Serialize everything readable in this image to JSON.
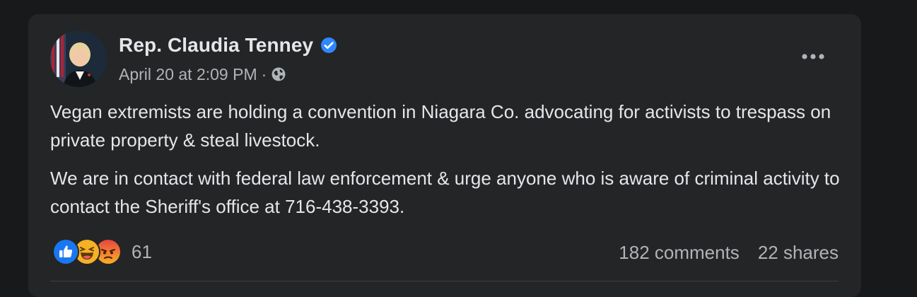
{
  "post": {
    "author_name": "Rep. Claudia Tenney",
    "verified_icon": "verified-badge-icon",
    "timestamp": "April 20 at 2:09 PM",
    "separator": "·",
    "audience_icon": "globe-icon",
    "more_icon": "more-options-icon",
    "paragraphs": [
      "Vegan extremists are holding a convention in Niagara Co. advocating for activists to trespass on private property & steal livestock.",
      "We are in contact with federal law enforcement & urge anyone who is aware of criminal activity to contact the Sheriff's office at 716-438-3393."
    ]
  },
  "engagement": {
    "reaction_icons": [
      "like-reaction-icon",
      "haha-reaction-icon",
      "angry-reaction-icon"
    ],
    "reaction_count": "61",
    "comments": "182 comments",
    "shares": "22 shares"
  },
  "colors": {
    "background": "#18191a",
    "card": "#242526",
    "primary_text": "#e4e6eb",
    "secondary_text": "#b0b3b8",
    "verified_blue": "#2d88ff",
    "like_blue": "#1877f2",
    "haha_yellow": "#f7b125",
    "angry_orange": "#e9710f"
  }
}
